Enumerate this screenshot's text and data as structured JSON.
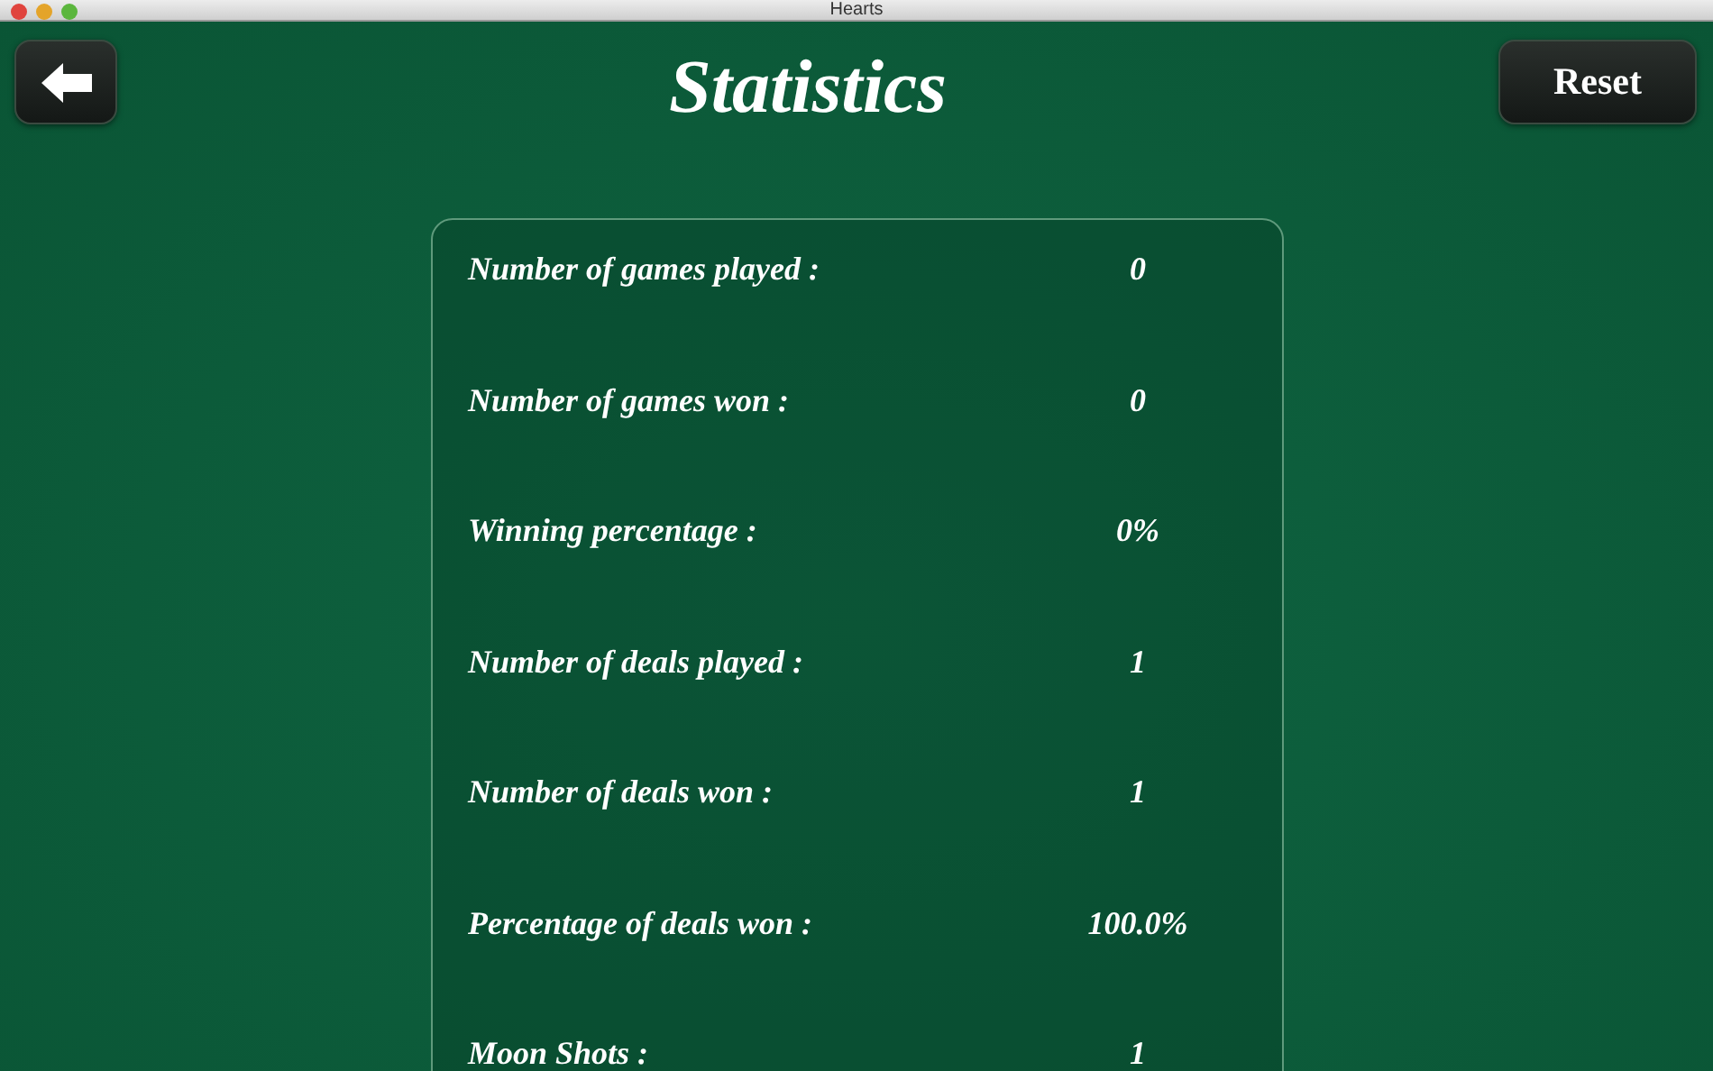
{
  "window": {
    "title": "Hearts"
  },
  "header": {
    "title": "Statistics",
    "reset_button": "Reset"
  },
  "stats": [
    {
      "label": "Number of games played :",
      "value": "0"
    },
    {
      "label": "Number of games won :",
      "value": "0"
    },
    {
      "label": "Winning percentage :",
      "value": "0%"
    },
    {
      "label": "Number of deals played :",
      "value": "1"
    },
    {
      "label": "Number of deals won :",
      "value": "1"
    },
    {
      "label": "Percentage of deals won :",
      "value": "100.0%"
    },
    {
      "label": "Moon Shots :",
      "value": "1"
    }
  ]
}
